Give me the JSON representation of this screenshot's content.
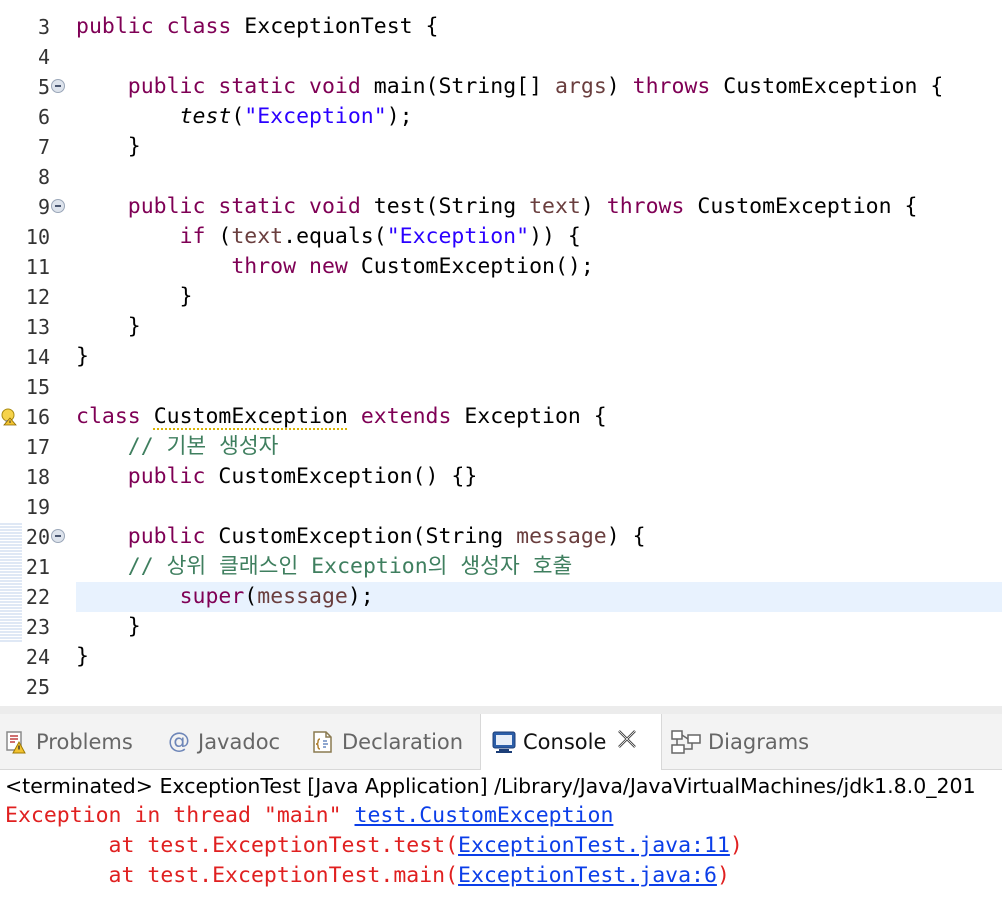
{
  "editor": {
    "lines": [
      {
        "n": "3",
        "fold": false,
        "segs": [
          {
            "c": "kw",
            "t": "public"
          },
          {
            "t": " "
          },
          {
            "c": "kw",
            "t": "class"
          },
          {
            "t": " ExceptionTest {"
          }
        ]
      },
      {
        "n": "4",
        "fold": false,
        "segs": []
      },
      {
        "n": "5",
        "fold": true,
        "segs": [
          {
            "t": "    "
          },
          {
            "c": "kw",
            "t": "public"
          },
          {
            "t": " "
          },
          {
            "c": "kw",
            "t": "static"
          },
          {
            "t": " "
          },
          {
            "c": "kw",
            "t": "void"
          },
          {
            "t": " main(String[] "
          },
          {
            "c": "prm",
            "t": "args"
          },
          {
            "t": ") "
          },
          {
            "c": "kw",
            "t": "throws"
          },
          {
            "t": " CustomException {"
          }
        ]
      },
      {
        "n": "6",
        "fold": false,
        "segs": [
          {
            "t": "        "
          },
          {
            "c": "it",
            "t": "test"
          },
          {
            "t": "("
          },
          {
            "c": "str",
            "t": "\"Exception\""
          },
          {
            "t": ");"
          }
        ]
      },
      {
        "n": "7",
        "fold": false,
        "segs": [
          {
            "t": "    }"
          }
        ]
      },
      {
        "n": "8",
        "fold": false,
        "segs": []
      },
      {
        "n": "9",
        "fold": true,
        "segs": [
          {
            "t": "    "
          },
          {
            "c": "kw",
            "t": "public"
          },
          {
            "t": " "
          },
          {
            "c": "kw",
            "t": "static"
          },
          {
            "t": " "
          },
          {
            "c": "kw",
            "t": "void"
          },
          {
            "t": " test(String "
          },
          {
            "c": "prm",
            "t": "text"
          },
          {
            "t": ") "
          },
          {
            "c": "kw",
            "t": "throws"
          },
          {
            "t": " CustomException {"
          }
        ]
      },
      {
        "n": "10",
        "fold": false,
        "segs": [
          {
            "t": "        "
          },
          {
            "c": "kw",
            "t": "if"
          },
          {
            "t": " ("
          },
          {
            "c": "prm",
            "t": "text"
          },
          {
            "t": ".equals("
          },
          {
            "c": "str",
            "t": "\"Exception\""
          },
          {
            "t": ")) {"
          }
        ]
      },
      {
        "n": "11",
        "fold": false,
        "segs": [
          {
            "t": "            "
          },
          {
            "c": "kw",
            "t": "throw"
          },
          {
            "t": " "
          },
          {
            "c": "kw",
            "t": "new"
          },
          {
            "t": " CustomException();"
          }
        ]
      },
      {
        "n": "12",
        "fold": false,
        "segs": [
          {
            "t": "        }"
          }
        ]
      },
      {
        "n": "13",
        "fold": false,
        "segs": [
          {
            "t": "    }"
          }
        ]
      },
      {
        "n": "14",
        "fold": false,
        "segs": [
          {
            "t": "}"
          }
        ]
      },
      {
        "n": "15",
        "fold": false,
        "segs": []
      },
      {
        "n": "16",
        "fold": false,
        "warn": true,
        "segs": [
          {
            "c": "kw",
            "t": "class"
          },
          {
            "t": " "
          },
          {
            "c": "warn-ul",
            "t": "CustomException"
          },
          {
            "t": " "
          },
          {
            "c": "kw",
            "t": "extends"
          },
          {
            "t": " Exception {"
          }
        ]
      },
      {
        "n": "17",
        "fold": false,
        "segs": [
          {
            "t": "    "
          },
          {
            "c": "cm",
            "t": "// 기본 생성자"
          }
        ]
      },
      {
        "n": "18",
        "fold": false,
        "segs": [
          {
            "t": "    "
          },
          {
            "c": "kw",
            "t": "public"
          },
          {
            "t": " CustomException() {}"
          }
        ]
      },
      {
        "n": "19",
        "fold": false,
        "segs": []
      },
      {
        "n": "20",
        "fold": true,
        "segs": [
          {
            "t": "    "
          },
          {
            "c": "kw",
            "t": "public"
          },
          {
            "t": " CustomException(String "
          },
          {
            "c": "prm",
            "t": "message"
          },
          {
            "t": ") {"
          }
        ]
      },
      {
        "n": "21",
        "fold": false,
        "segs": [
          {
            "t": "    "
          },
          {
            "c": "cm",
            "t": "// 상위 클래스인 Exception의 생성자 호출"
          }
        ]
      },
      {
        "n": "22",
        "fold": false,
        "current": true,
        "segs": [
          {
            "t": "        "
          },
          {
            "c": "kw",
            "t": "super"
          },
          {
            "t": "("
          },
          {
            "c": "prm",
            "t": "message"
          },
          {
            "t": ");"
          }
        ]
      },
      {
        "n": "23",
        "fold": false,
        "segs": [
          {
            "t": "    }"
          }
        ]
      },
      {
        "n": "24",
        "fold": false,
        "segs": [
          {
            "t": "}"
          }
        ]
      },
      {
        "n": "25",
        "fold": false,
        "segs": []
      }
    ]
  },
  "tabs": {
    "problems": "Problems",
    "javadoc": "Javadoc",
    "declaration": "Declaration",
    "console": "Console",
    "diagrams": "Diagrams"
  },
  "console": {
    "header": "<terminated> ExceptionTest [Java Application] /Library/Java/JavaVirtualMachines/jdk1.8.0_201",
    "line1_prefix": "Exception in thread \"main\" ",
    "line1_link": "test.CustomException",
    "line2_prefix": "        at test.ExceptionTest.test(",
    "line2_link": "ExceptionTest.java:11",
    "line2_suffix": ")",
    "line3_prefix": "        at test.ExceptionTest.main(",
    "line3_link": "ExceptionTest.java:6",
    "line3_suffix": ")"
  },
  "colors": {
    "keyword": "#7f0055",
    "string": "#2a00ff",
    "comment": "#3f7f5f",
    "error": "#e02020",
    "link": "#0b3ee8",
    "current_line": "#e8f2fe"
  }
}
